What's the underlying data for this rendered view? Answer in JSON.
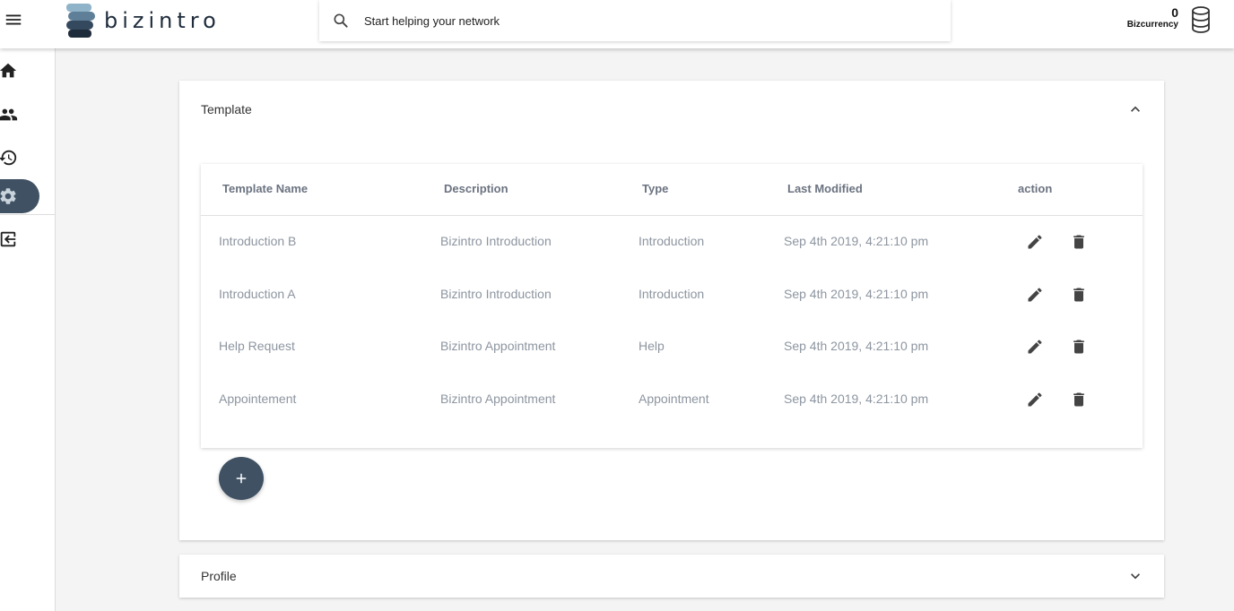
{
  "header": {
    "logo_text": "bizintro",
    "search_placeholder": "Start helping your network",
    "currency_value": "0",
    "currency_label": "Bizcurrency"
  },
  "sidebar": {
    "items": [
      {
        "icon": "home-icon",
        "active": false
      },
      {
        "icon": "people-icon",
        "active": false
      },
      {
        "icon": "history-icon",
        "active": false
      },
      {
        "icon": "settings-icon",
        "active": true
      },
      {
        "icon": "logout-icon",
        "active": false
      }
    ]
  },
  "template_panel": {
    "title": "Template",
    "expanded": true,
    "columns": [
      "Template Name",
      "Description",
      "Type",
      "Last Modified",
      "action"
    ],
    "rows": [
      {
        "name": "Introduction B",
        "description": "Bizintro Introduction",
        "type": "Introduction",
        "modified": "Sep 4th 2019, 4:21:10 pm"
      },
      {
        "name": "Introduction A",
        "description": "Bizintro Introduction",
        "type": "Introduction",
        "modified": "Sep 4th 2019, 4:21:10 pm"
      },
      {
        "name": "Help Request",
        "description": "Bizintro Appointment",
        "type": "Help",
        "modified": "Sep 4th 2019, 4:21:10 pm"
      },
      {
        "name": "Appointement",
        "description": "Bizintro Appointment",
        "type": "Appointment",
        "modified": "Sep 4th 2019, 4:21:10 pm"
      }
    ],
    "add_label": "+"
  },
  "profile_panel": {
    "title": "Profile",
    "expanded": false
  },
  "colors": {
    "accent": "#3f5163",
    "muted_text": "#8d95a0"
  }
}
